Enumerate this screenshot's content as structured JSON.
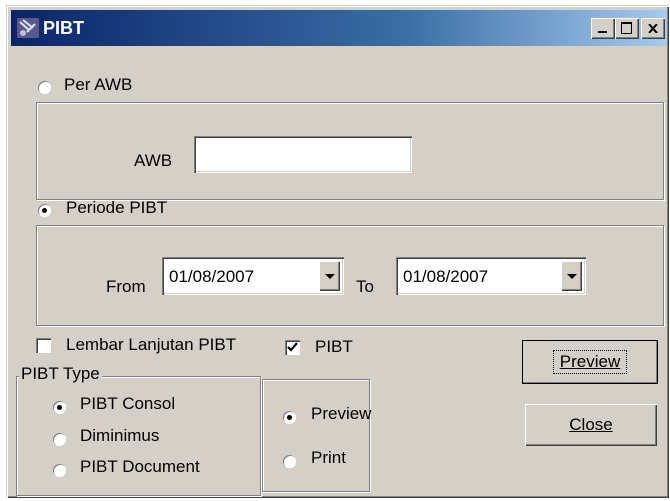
{
  "window": {
    "title": "PIBT",
    "minimize": "_",
    "maximize": "□",
    "close": "×"
  },
  "per_awb": {
    "radio_label": "Per AWB",
    "selected": false,
    "awb_label": "AWB",
    "awb_value": ""
  },
  "periode": {
    "radio_label": "Periode PIBT",
    "selected": true,
    "from_label": "From",
    "from_value": "01/08/2007",
    "to_label": "To",
    "to_value": "01/08/2007"
  },
  "options": {
    "lembar_label": "Lembar Lanjutan PIBT",
    "lembar_checked": false,
    "pibt_label": "PIBT",
    "pibt_checked": true
  },
  "pibt_type": {
    "legend": "PIBT Type",
    "items": [
      {
        "label": "PIBT Consol",
        "selected": true
      },
      {
        "label": "Diminimus",
        "selected": false
      },
      {
        "label": "PIBT Document",
        "selected": false
      }
    ]
  },
  "output": {
    "items": [
      {
        "label": "Preview",
        "selected": true
      },
      {
        "label": "Print",
        "selected": false
      }
    ]
  },
  "buttons": {
    "preview": "Preview",
    "close": "Close"
  }
}
